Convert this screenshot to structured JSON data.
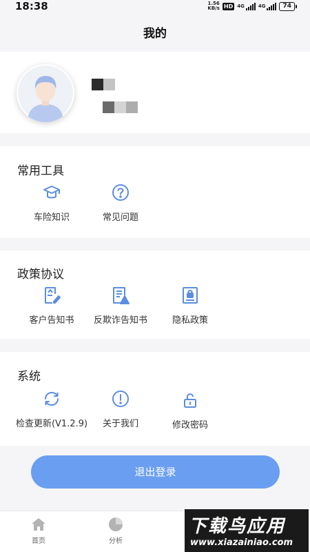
{
  "status_bar": {
    "time": "18:38",
    "net_speed_value": "1.56",
    "net_speed_unit": "KB/s",
    "hd": "HD",
    "net1": "4G",
    "net2": "4G",
    "battery": "74"
  },
  "header": {
    "title": "我的"
  },
  "profile": {
    "avatar_icon": "user-avatar-icon"
  },
  "sections": {
    "tools": {
      "title": "常用工具",
      "items": [
        {
          "label": "车险知识",
          "icon": "graduation-cap-icon"
        },
        {
          "label": "常见问题",
          "icon": "question-circle-icon"
        }
      ]
    },
    "policy": {
      "title": "政策协议",
      "items": [
        {
          "label": "客户告知书",
          "icon": "document-edit-icon"
        },
        {
          "label": "反欺诈告知书",
          "icon": "document-warning-icon"
        },
        {
          "label": "隐私政策",
          "icon": "document-lock-icon"
        }
      ]
    },
    "system": {
      "title": "系统",
      "items": [
        {
          "label": "检查更新(V1.2.9)",
          "icon": "refresh-icon"
        },
        {
          "label": "关于我们",
          "icon": "info-circle-icon"
        },
        {
          "label": "修改密码",
          "icon": "unlock-icon"
        }
      ]
    }
  },
  "logout_button": {
    "label": "退出登录"
  },
  "tabbar": {
    "tabs": [
      {
        "label": "首页",
        "icon": "home-icon"
      },
      {
        "label": "分析",
        "icon": "pie-chart-icon"
      }
    ]
  },
  "watermark": {
    "text": "下载鸟应用",
    "url": "www.xiazainiao.com"
  },
  "colors": {
    "accent": "#6a9ef0",
    "icon": "#5b8de0",
    "background": "#f5f5f7"
  }
}
